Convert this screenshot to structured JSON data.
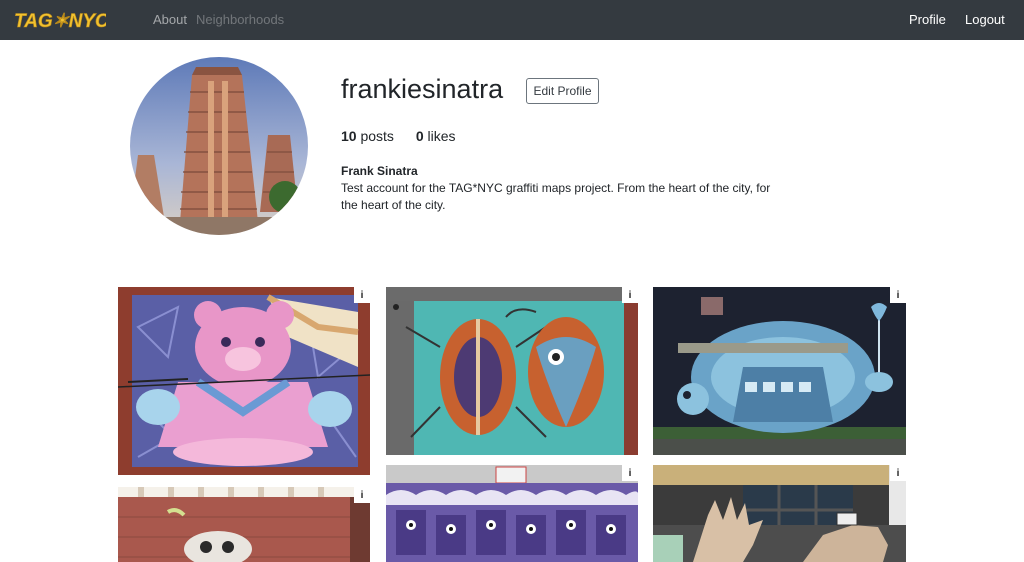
{
  "navbar": {
    "brand": "TAG*NYC",
    "links": [
      {
        "label": "About"
      },
      {
        "label": "Neighborhoods"
      }
    ],
    "right_links": [
      {
        "label": "Profile"
      },
      {
        "label": "Logout"
      }
    ]
  },
  "profile": {
    "username": "frankiesinatra",
    "edit_label": "Edit Profile",
    "posts_count": "10",
    "posts_label": "posts",
    "likes_count": "0",
    "likes_label": "likes",
    "full_name": "Frank Sinatra",
    "bio": "Test account for the TAG*NYC graffiti maps project. From the heart of the city, for the heart of the city."
  },
  "grid": {
    "info_label": "i",
    "posts": [
      {
        "icon": "mural-pink-bear"
      },
      {
        "icon": "mural-beetle-fish"
      },
      {
        "icon": "mural-blue-pufferfish"
      },
      {
        "icon": "mural-skull"
      },
      {
        "icon": "mural-purple-monsters"
      },
      {
        "icon": "mural-hands"
      }
    ]
  },
  "colors": {
    "navbar_bg": "#343a40",
    "brand_yellow": "#f2c230"
  }
}
